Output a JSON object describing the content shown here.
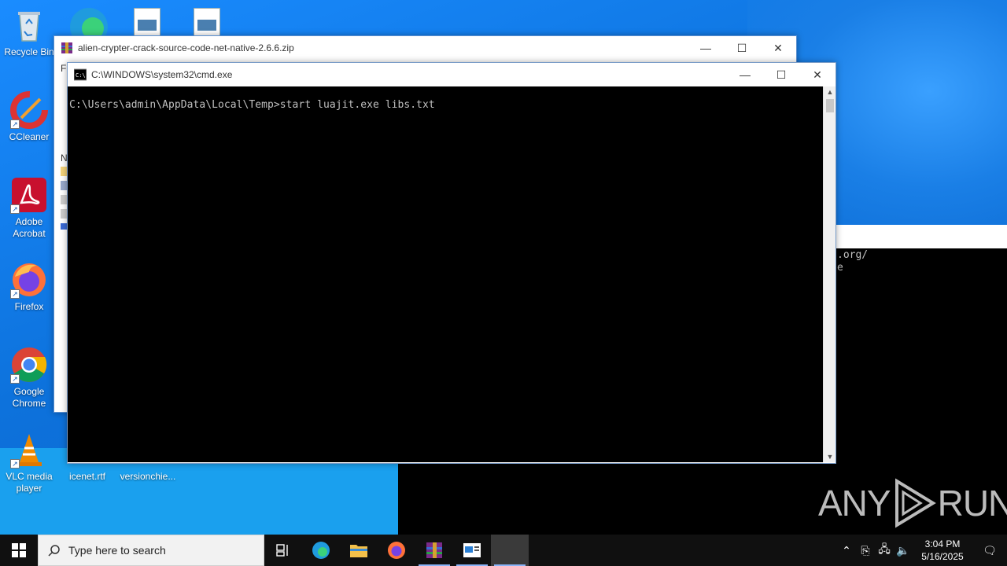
{
  "desktop": {
    "icons": [
      {
        "label": "Recycle Bin"
      },
      {
        "label": "CCleaner"
      },
      {
        "label": "Adobe Acrobat"
      },
      {
        "label": "Firefox"
      },
      {
        "label": "Google Chrome"
      },
      {
        "label": "VLC media player"
      },
      {
        "label": "icenet.rtf"
      },
      {
        "label": "versionchie..."
      }
    ]
  },
  "archive_window": {
    "title": "alien-crypter-crack-source-code-net-native-2.6.6.zip",
    "menu_fragment": "Fi",
    "list_fragment": "N"
  },
  "cmd_window": {
    "title": "C:\\WINDOWS\\system32\\cmd.exe",
    "console_line": "C:\\Users\\admin\\AppData\\Local\\Temp>start luajit.exe libs.txt"
  },
  "background_console": {
    "line1": ".org/",
    "line2": "e"
  },
  "taskbar": {
    "search_placeholder": "Type here to search",
    "time": "3:04 PM",
    "date": "5/16/2025"
  },
  "watermark": {
    "text_left": "ANY",
    "text_right": "RUN"
  },
  "colors": {
    "desktop_blue": "#0d72dc",
    "console_bg": "#000000",
    "console_text": "#c0c0c0",
    "taskbar": "#101010"
  }
}
